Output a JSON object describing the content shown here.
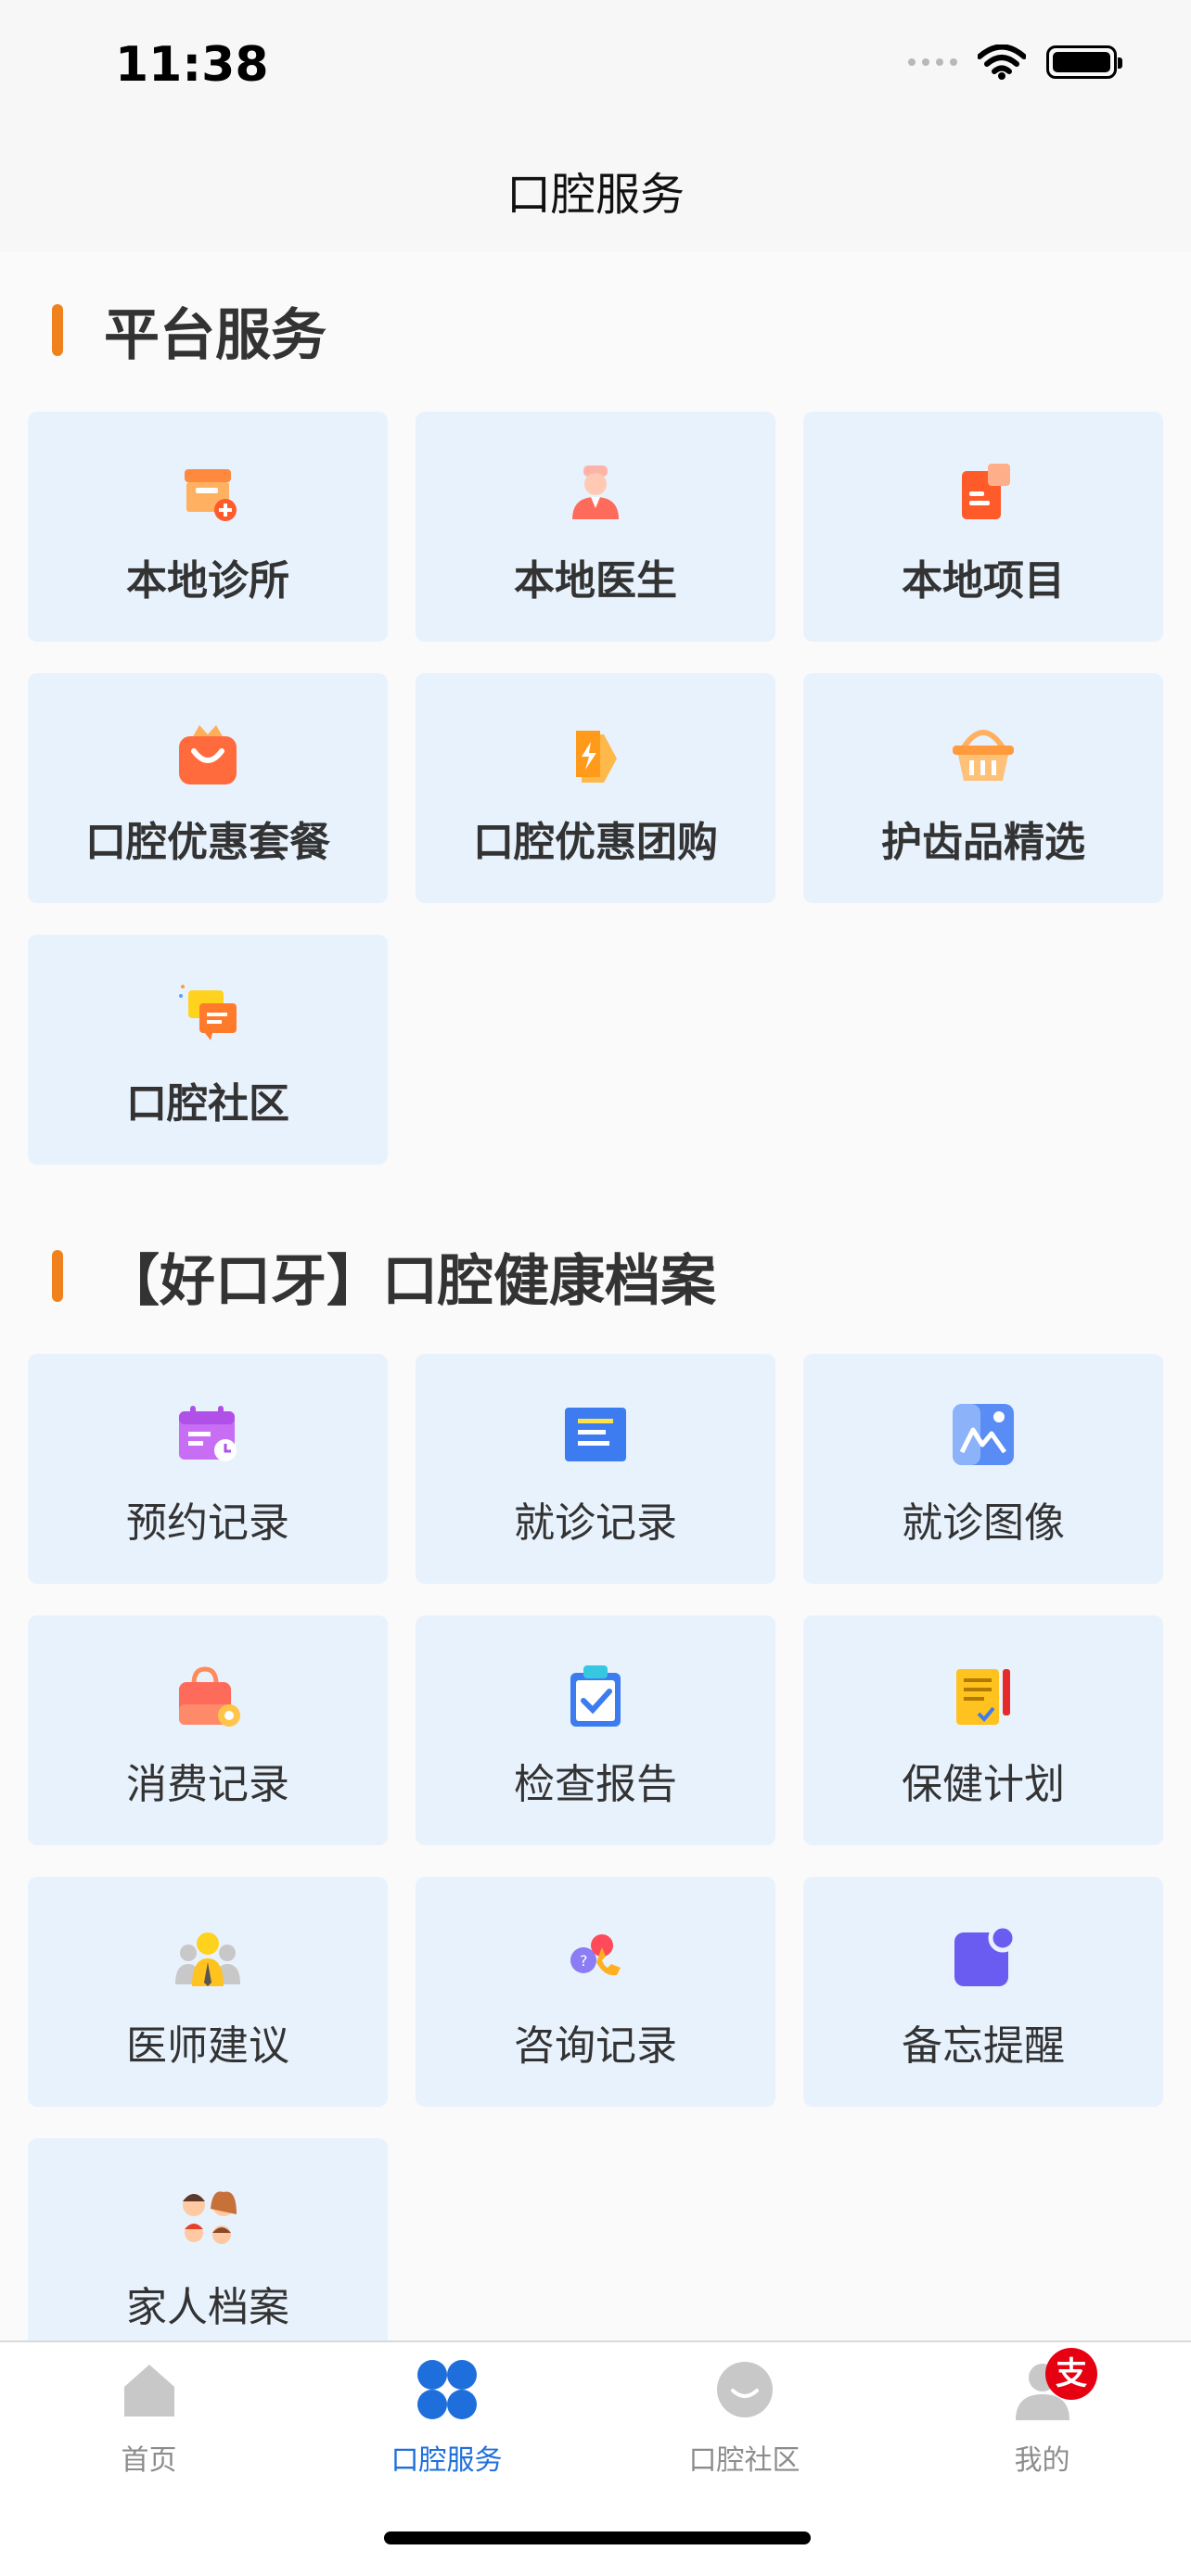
{
  "status_bar": {
    "time": "11:38"
  },
  "nav": {
    "title": "口腔服务"
  },
  "sections": [
    {
      "title": "平台服务",
      "items": [
        {
          "label": "本地诊所",
          "icon": "clinic-store-icon"
        },
        {
          "label": "本地医生",
          "icon": "doctor-icon"
        },
        {
          "label": "本地项目",
          "icon": "project-document-icon"
        },
        {
          "label": "口腔优惠套餐",
          "icon": "shopping-bag-icon"
        },
        {
          "label": "口腔优惠团购",
          "icon": "lightning-tag-icon"
        },
        {
          "label": "护齿品精选",
          "icon": "basket-icon"
        },
        {
          "label": "口腔社区",
          "icon": "chat-bubbles-icon"
        }
      ]
    },
    {
      "title": "【好口牙】口腔健康档案",
      "items": [
        {
          "label": "预约记录",
          "icon": "calendar-icon"
        },
        {
          "label": "就诊记录",
          "icon": "record-card-icon"
        },
        {
          "label": "就诊图像",
          "icon": "image-icon"
        },
        {
          "label": "消费记录",
          "icon": "handbag-coin-icon"
        },
        {
          "label": "检查报告",
          "icon": "clipboard-check-icon"
        },
        {
          "label": "保健计划",
          "icon": "notepad-plan-icon"
        },
        {
          "label": "医师建议",
          "icon": "doctor-advice-icon"
        },
        {
          "label": "咨询记录",
          "icon": "consult-phone-icon"
        },
        {
          "label": "备忘提醒",
          "icon": "reminder-icon"
        },
        {
          "label": "家人档案",
          "icon": "family-icon"
        }
      ]
    }
  ],
  "tabbar": {
    "tabs": [
      {
        "label": "首页",
        "icon": "home-icon",
        "active": false
      },
      {
        "label": "口腔服务",
        "icon": "four-petal-icon",
        "active": true
      },
      {
        "label": "口腔社区",
        "icon": "smile-icon",
        "active": false
      },
      {
        "label": "我的",
        "icon": "user-icon",
        "active": false,
        "badge": "支"
      }
    ]
  },
  "colors": {
    "accent": "#1e6fdc",
    "section_bar": "#f0821e",
    "tile_bg": "#e8f2fd",
    "badge": "#e60012"
  }
}
